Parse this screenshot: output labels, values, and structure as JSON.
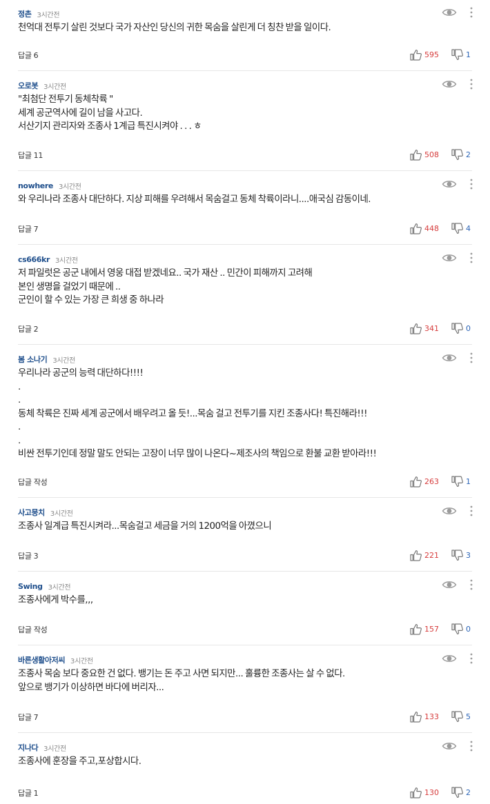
{
  "ui": {
    "colors": {
      "nickname": "#1f4f8c",
      "like": "#d63c3c",
      "dislike": "#2b64b6",
      "icon": "#9a9a9a",
      "divider": "#e6e6e6"
    },
    "icons": [
      "eye-icon",
      "more-vertical-icon",
      "thumbs-up-icon",
      "thumbs-down-icon"
    ]
  },
  "comments": [
    {
      "nickname": "정촌",
      "time": "3시간전",
      "text": "천억대 전투기 살린 것보다 국가 자산인 당신의 귀한 목숨을 살린게 더 칭찬 받을 일이다.",
      "reply_label": "답글",
      "reply_count": "6",
      "likes": "595",
      "dislikes": "1"
    },
    {
      "nickname": "오로봇",
      "time": "3시간전",
      "text": "\"최첨단 전투기 동체착륙 \"\n세계 공군역사에 길이 남을 사고다.\n서산기지 관리자와 조종사 1계급 특진시켜야 . . .   ㅎ",
      "reply_label": "답글",
      "reply_count": "11",
      "likes": "508",
      "dislikes": "2"
    },
    {
      "nickname": "nowhere",
      "time": "3시간전",
      "text": "와 우리나라 조종사 대단하다. 지상 피해를 우려해서 목숨걸고 동체 착륙이라니....애국심 감동이네.",
      "reply_label": "답글",
      "reply_count": "7",
      "likes": "448",
      "dislikes": "4"
    },
    {
      "nickname": "cs666kr",
      "time": "3시간전",
      "text": "저 파일럿은 공군 내에서 영웅 대접 받겠네요.. 국가 재산 .. 민간이 피해까지 고려해\n본인 생명을 걸었기 때문에 ..\n군인이 할 수 있는 가장 큰 희생 중 하나라",
      "reply_label": "답글",
      "reply_count": "2",
      "likes": "341",
      "dislikes": "0"
    },
    {
      "nickname": "봄 소나기",
      "time": "3시간전",
      "text": "우리나라 공군의 능력 대단하다!!!!\n.\n.\n동체 착륙은  진짜 세계 공군에서  배우려고 올 듯!...목숨 걸고 전투기를 지킨 조종사다! 특진해라!!!\n.\n.\n비싼 전투기인데 정말 말도 안되는 고장이 너무 많이 나온다~제조사의 책임으로 환불 교환 받아라!!!",
      "reply_label": "답글 작성",
      "reply_count": "",
      "likes": "263",
      "dislikes": "1"
    },
    {
      "nickname": "사고뭉치",
      "time": "3시간전",
      "text": "조종사 일계급 특진시켜라...목숨걸고  세금을 거의 1200억을 아꼈으니",
      "reply_label": "답글",
      "reply_count": "3",
      "likes": "221",
      "dislikes": "3"
    },
    {
      "nickname": "Swing",
      "time": "3시간전",
      "text": "조종사에게 박수를,,,",
      "reply_label": "답글 작성",
      "reply_count": "",
      "likes": "157",
      "dislikes": "0"
    },
    {
      "nickname": "바른생활아저씨",
      "time": "3시간전",
      "text": "조종사 목숨 보다 중요한 건 없다. 뱅기는 돈 주고 사면 되지만... 훌륭한 조종사는 살 수 없다.\n앞으로 뱅기가 이상하면 바다에 버리자...",
      "reply_label": "답글",
      "reply_count": "7",
      "likes": "133",
      "dislikes": "5"
    },
    {
      "nickname": "지나다",
      "time": "3시간전",
      "text": "조종사에 훈장을 주고,포상합시다.",
      "reply_label": "답글",
      "reply_count": "1",
      "likes": "130",
      "dislikes": "2"
    }
  ]
}
